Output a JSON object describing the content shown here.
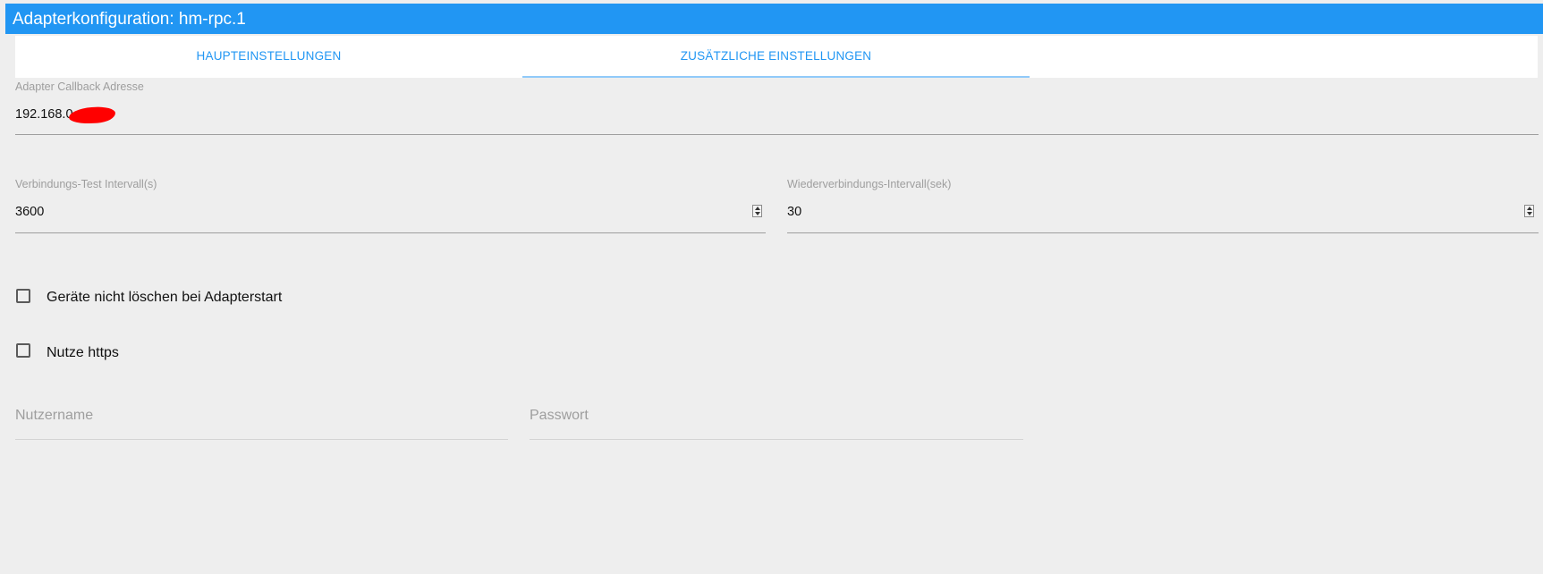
{
  "window": {
    "title": "Adapterkonfiguration: hm-rpc.1"
  },
  "tabs": [
    {
      "label": "HAUPTEINSTELLUNGEN",
      "active": false
    },
    {
      "label": "ZUSÄTZLICHE EINSTELLUNGEN",
      "active": true
    }
  ],
  "callback": {
    "label": "Adapter Callback Adresse",
    "value": "192.168.0"
  },
  "connection_test": {
    "label": "Verbindungs-Test Intervall(s)",
    "value": "3600"
  },
  "reconnect": {
    "label": "Wiederverbindungs-Intervall(sek)",
    "value": "30"
  },
  "checkboxes": [
    {
      "label": "Geräte nicht löschen bei Adapterstart",
      "checked": false
    },
    {
      "label": "Nutze https",
      "checked": false
    }
  ],
  "username": {
    "placeholder": "Nutzername",
    "value": ""
  },
  "password": {
    "placeholder": "Passwort",
    "value": ""
  },
  "colors": {
    "accent": "#2196f3",
    "background": "#eeeeee",
    "redaction": "#ff0000"
  }
}
